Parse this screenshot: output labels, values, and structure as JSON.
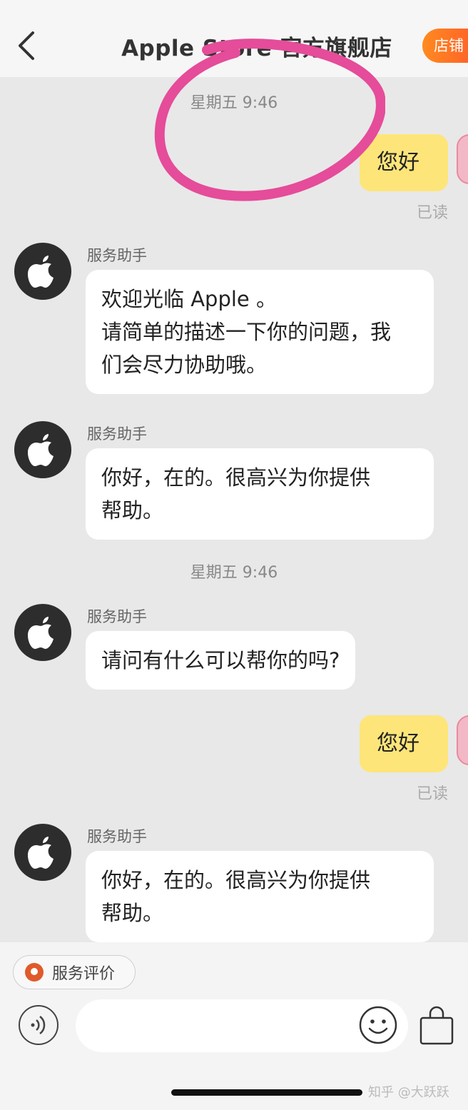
{
  "header": {
    "title": "Apple Store 官方旗舰店",
    "shop_button": "店铺"
  },
  "chat": {
    "timestamps": [
      "星期五 9:46",
      "星期五 9:46"
    ],
    "messages": [
      {
        "from": "me",
        "text": "您好",
        "status": "已读"
      },
      {
        "from": "bot",
        "sender": "服务助手",
        "lines": [
          "欢迎光临 Apple 。",
          "请简单的描述一下你的问题，我",
          "们会尽力协助哦。"
        ]
      },
      {
        "from": "bot",
        "sender": "服务助手",
        "lines": [
          "你好，在的。很高兴为你提供",
          "帮助。"
        ]
      },
      {
        "from": "bot",
        "sender": "服务助手",
        "lines": [
          "请问有什么可以帮你的吗?"
        ]
      },
      {
        "from": "me",
        "text": "您好",
        "status": "已读"
      },
      {
        "from": "bot",
        "sender": "服务助手",
        "lines": [
          "你好，在的。很高兴为你提供",
          "帮助。"
        ]
      }
    ]
  },
  "bottom": {
    "rate_label": "服务评价",
    "input_placeholder": ""
  },
  "watermark": "知乎 @大跃跃",
  "colors": {
    "my_bubble": "#fde57a",
    "shop_button": "#ff6a24",
    "annotation_circle": "#e54c9a"
  }
}
